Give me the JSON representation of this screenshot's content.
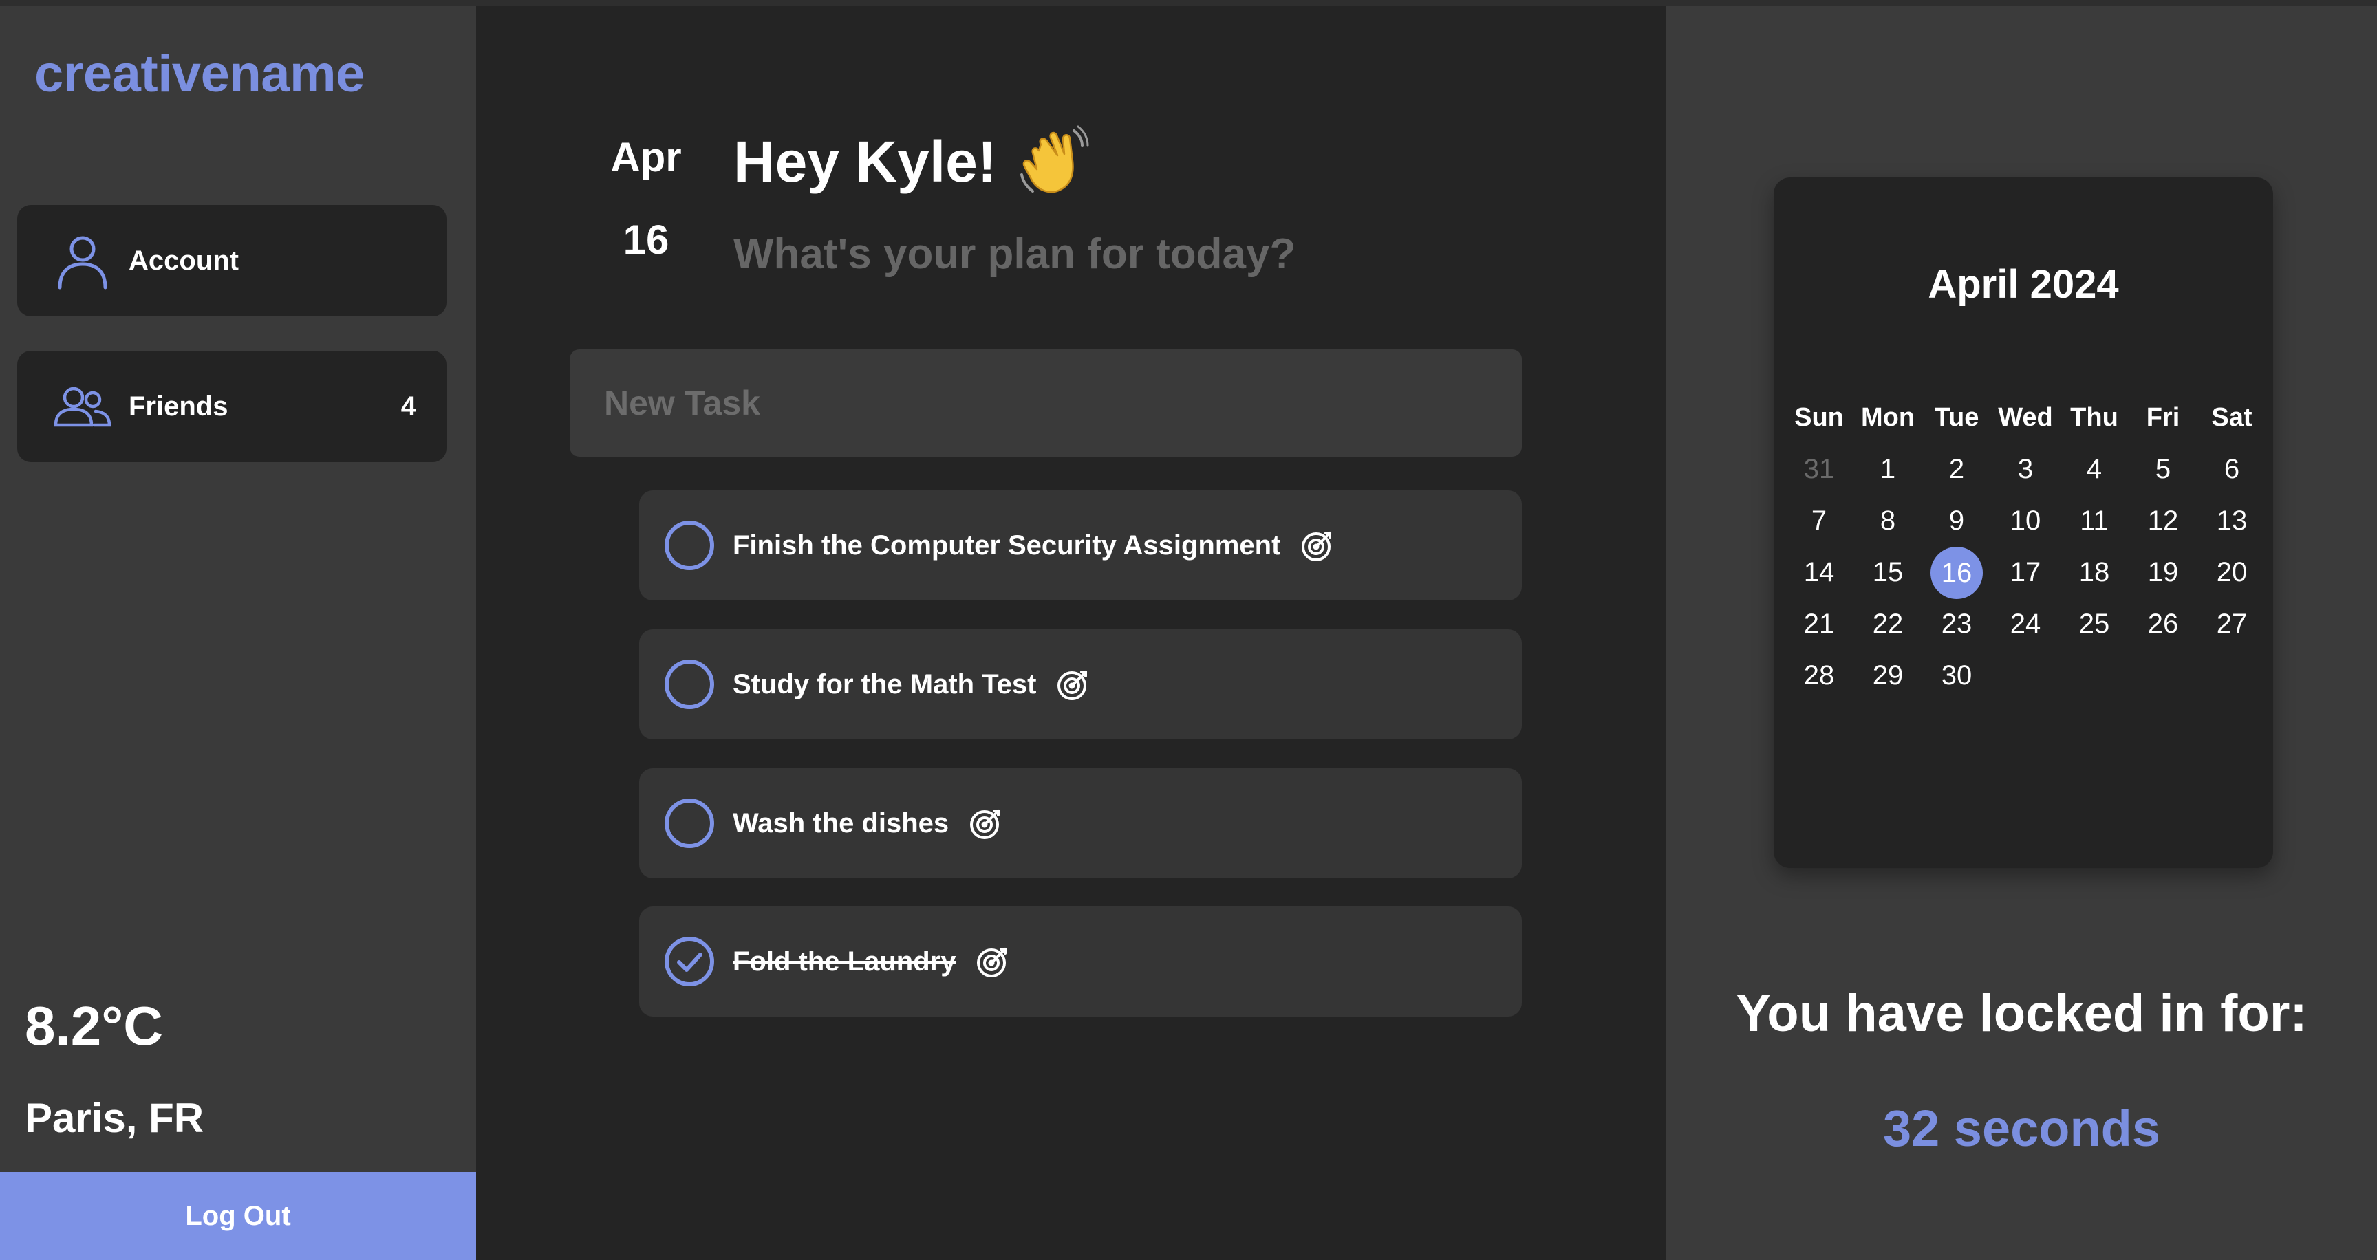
{
  "brand": "creativename",
  "colors": {
    "accent": "#7d92e6",
    "sidebar_bg": "#3a3a3a",
    "main_bg": "#242424",
    "card_bg": "#232323",
    "task_bg": "#353535",
    "muted_text": "#666666"
  },
  "sidebar": {
    "items": [
      {
        "label": "Account",
        "icon": "user-icon"
      },
      {
        "label": "Friends",
        "icon": "users-icon",
        "count": "4"
      }
    ],
    "weather": {
      "temperature": "8.2°C",
      "location": "Paris, FR"
    },
    "logout_label": "Log Out"
  },
  "main": {
    "date": {
      "month": "Apr",
      "day": "16"
    },
    "greeting": "Hey Kyle!",
    "greeting_emoji": "waving-hand-icon",
    "subtitle": "What's your plan for today?",
    "new_task_placeholder": "New Task",
    "new_task_value": "",
    "tasks": [
      {
        "label": "Finish the Computer Security Assignment",
        "done": false
      },
      {
        "label": "Study for the Math Test",
        "done": false
      },
      {
        "label": "Wash the dishes",
        "done": false
      },
      {
        "label": "Fold the Laundry",
        "done": true
      }
    ]
  },
  "calendar": {
    "title": "April 2024",
    "weekdays": [
      "Sun",
      "Mon",
      "Tue",
      "Wed",
      "Thu",
      "Fri",
      "Sat"
    ],
    "days": [
      {
        "n": "31",
        "muted": true
      },
      {
        "n": "1"
      },
      {
        "n": "2"
      },
      {
        "n": "3"
      },
      {
        "n": "4"
      },
      {
        "n": "5"
      },
      {
        "n": "6"
      },
      {
        "n": "7"
      },
      {
        "n": "8"
      },
      {
        "n": "9"
      },
      {
        "n": "10"
      },
      {
        "n": "11"
      },
      {
        "n": "12"
      },
      {
        "n": "13"
      },
      {
        "n": "14"
      },
      {
        "n": "15"
      },
      {
        "n": "16",
        "today": true
      },
      {
        "n": "17"
      },
      {
        "n": "18"
      },
      {
        "n": "19"
      },
      {
        "n": "20"
      },
      {
        "n": "21"
      },
      {
        "n": "22"
      },
      {
        "n": "23"
      },
      {
        "n": "24"
      },
      {
        "n": "25"
      },
      {
        "n": "26"
      },
      {
        "n": "27"
      },
      {
        "n": "28"
      },
      {
        "n": "29"
      },
      {
        "n": "30"
      }
    ]
  },
  "focus": {
    "label": "You have locked in for:",
    "value": "32 seconds"
  }
}
